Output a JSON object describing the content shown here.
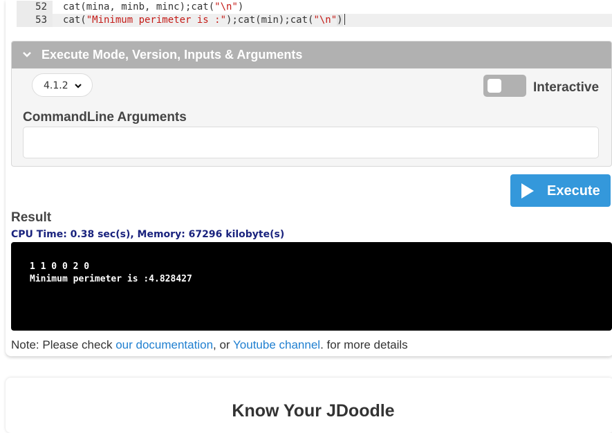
{
  "editor": {
    "lines": [
      {
        "number": "52",
        "segments": [
          {
            "text": "cat(mina, minb, minc);cat(",
            "kind": "plain"
          },
          {
            "text": "\"\\n\"",
            "kind": "string"
          },
          {
            "text": ")",
            "kind": "plain"
          }
        ]
      },
      {
        "number": "53",
        "segments": [
          {
            "text": "cat(",
            "kind": "plain"
          },
          {
            "text": "\"Minimum perimeter is :\"",
            "kind": "string"
          },
          {
            "text": ");cat(min);cat(",
            "kind": "plain"
          },
          {
            "text": "\"\\n\"",
            "kind": "string"
          },
          {
            "text": ")",
            "kind": "plain"
          }
        ]
      }
    ]
  },
  "execute_panel": {
    "title": "Execute Mode, Version, Inputs & Arguments",
    "chevron_icon": "chevron-down-icon",
    "version": "4.1.2",
    "interactive_label": "Interactive",
    "interactive_on": false,
    "args_label": "CommandLine Arguments",
    "args_value": ""
  },
  "execute_button": {
    "label": "Execute",
    "icon": "play-icon",
    "color": "#3498db"
  },
  "result": {
    "label": "Result",
    "stats": "CPU Time: 0.38 sec(s), Memory: 67296 kilobyte(s)",
    "output_lines": [
      "1 1 0 0 2 0",
      "Minimum perimeter is :4.828427"
    ]
  },
  "note": {
    "prefix": "Note: Please check ",
    "link1": "our documentation",
    "middle": ", or ",
    "link2": "Youtube channel",
    "suffix": ". for more details"
  },
  "section2": {
    "heading": "Know Your JDoodle"
  }
}
